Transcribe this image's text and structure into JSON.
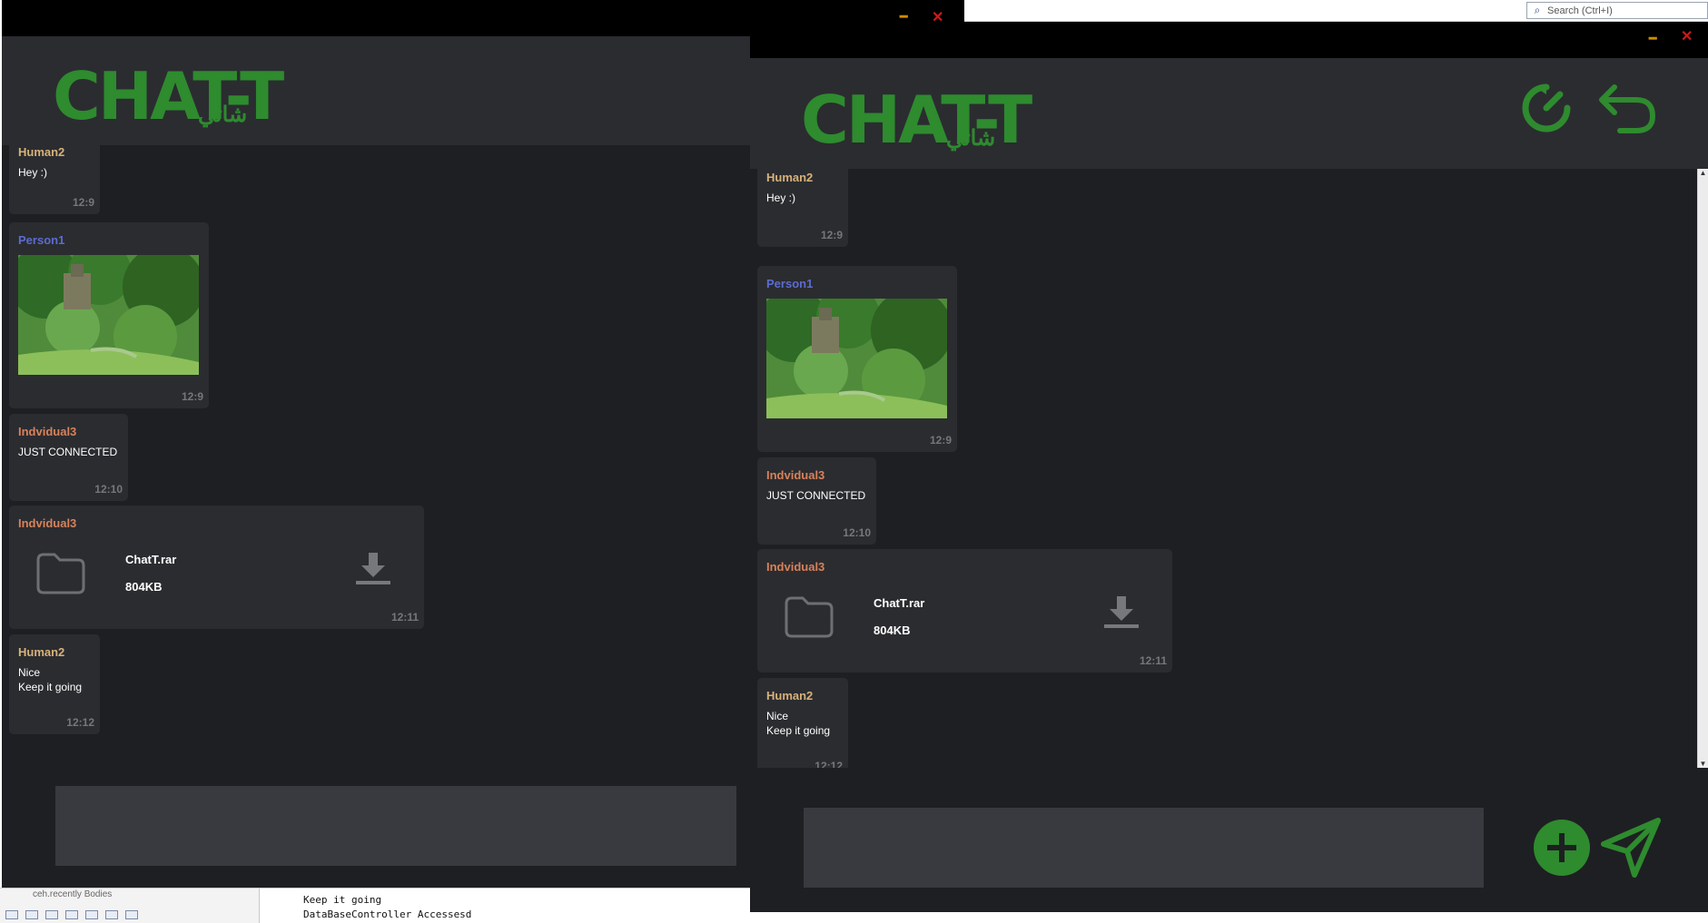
{
  "ide": {
    "search_placeholder": "Search (Ctrl+I)",
    "bottom_tab": "ceh.recently Bodies",
    "console_lines": [
      "Keep it going",
      "DataBaseController Accessesd"
    ]
  },
  "app": {
    "logo_text": "CHAT-T",
    "logo_arabic": "شاتي",
    "minimize_glyph": "━",
    "close_glyph": "✕",
    "colors": {
      "accent": "#2e8b2e",
      "background": "#1e1f22",
      "panel": "#2b2c30",
      "input": "#393a3f"
    }
  },
  "messages": [
    {
      "sender": "Human2",
      "text": "Hey :)",
      "time": "12:9"
    },
    {
      "sender": "Person1",
      "attachment": "image-forest",
      "time": "12:9"
    },
    {
      "sender": "Indvidual3",
      "text": "JUST CONNECTED",
      "time": "12:10"
    },
    {
      "sender": "Indvidual3",
      "file_name": "ChatT.rar",
      "file_size": "804KB",
      "time": "12:11"
    },
    {
      "sender": "Human2",
      "text": "Nice\nKeep it going",
      "time": "12:12"
    }
  ],
  "actions": {
    "refresh_icon": "refresh-icon",
    "back_icon": "back-arrow-icon",
    "attach_icon": "plus-icon",
    "send_icon": "send-icon"
  }
}
